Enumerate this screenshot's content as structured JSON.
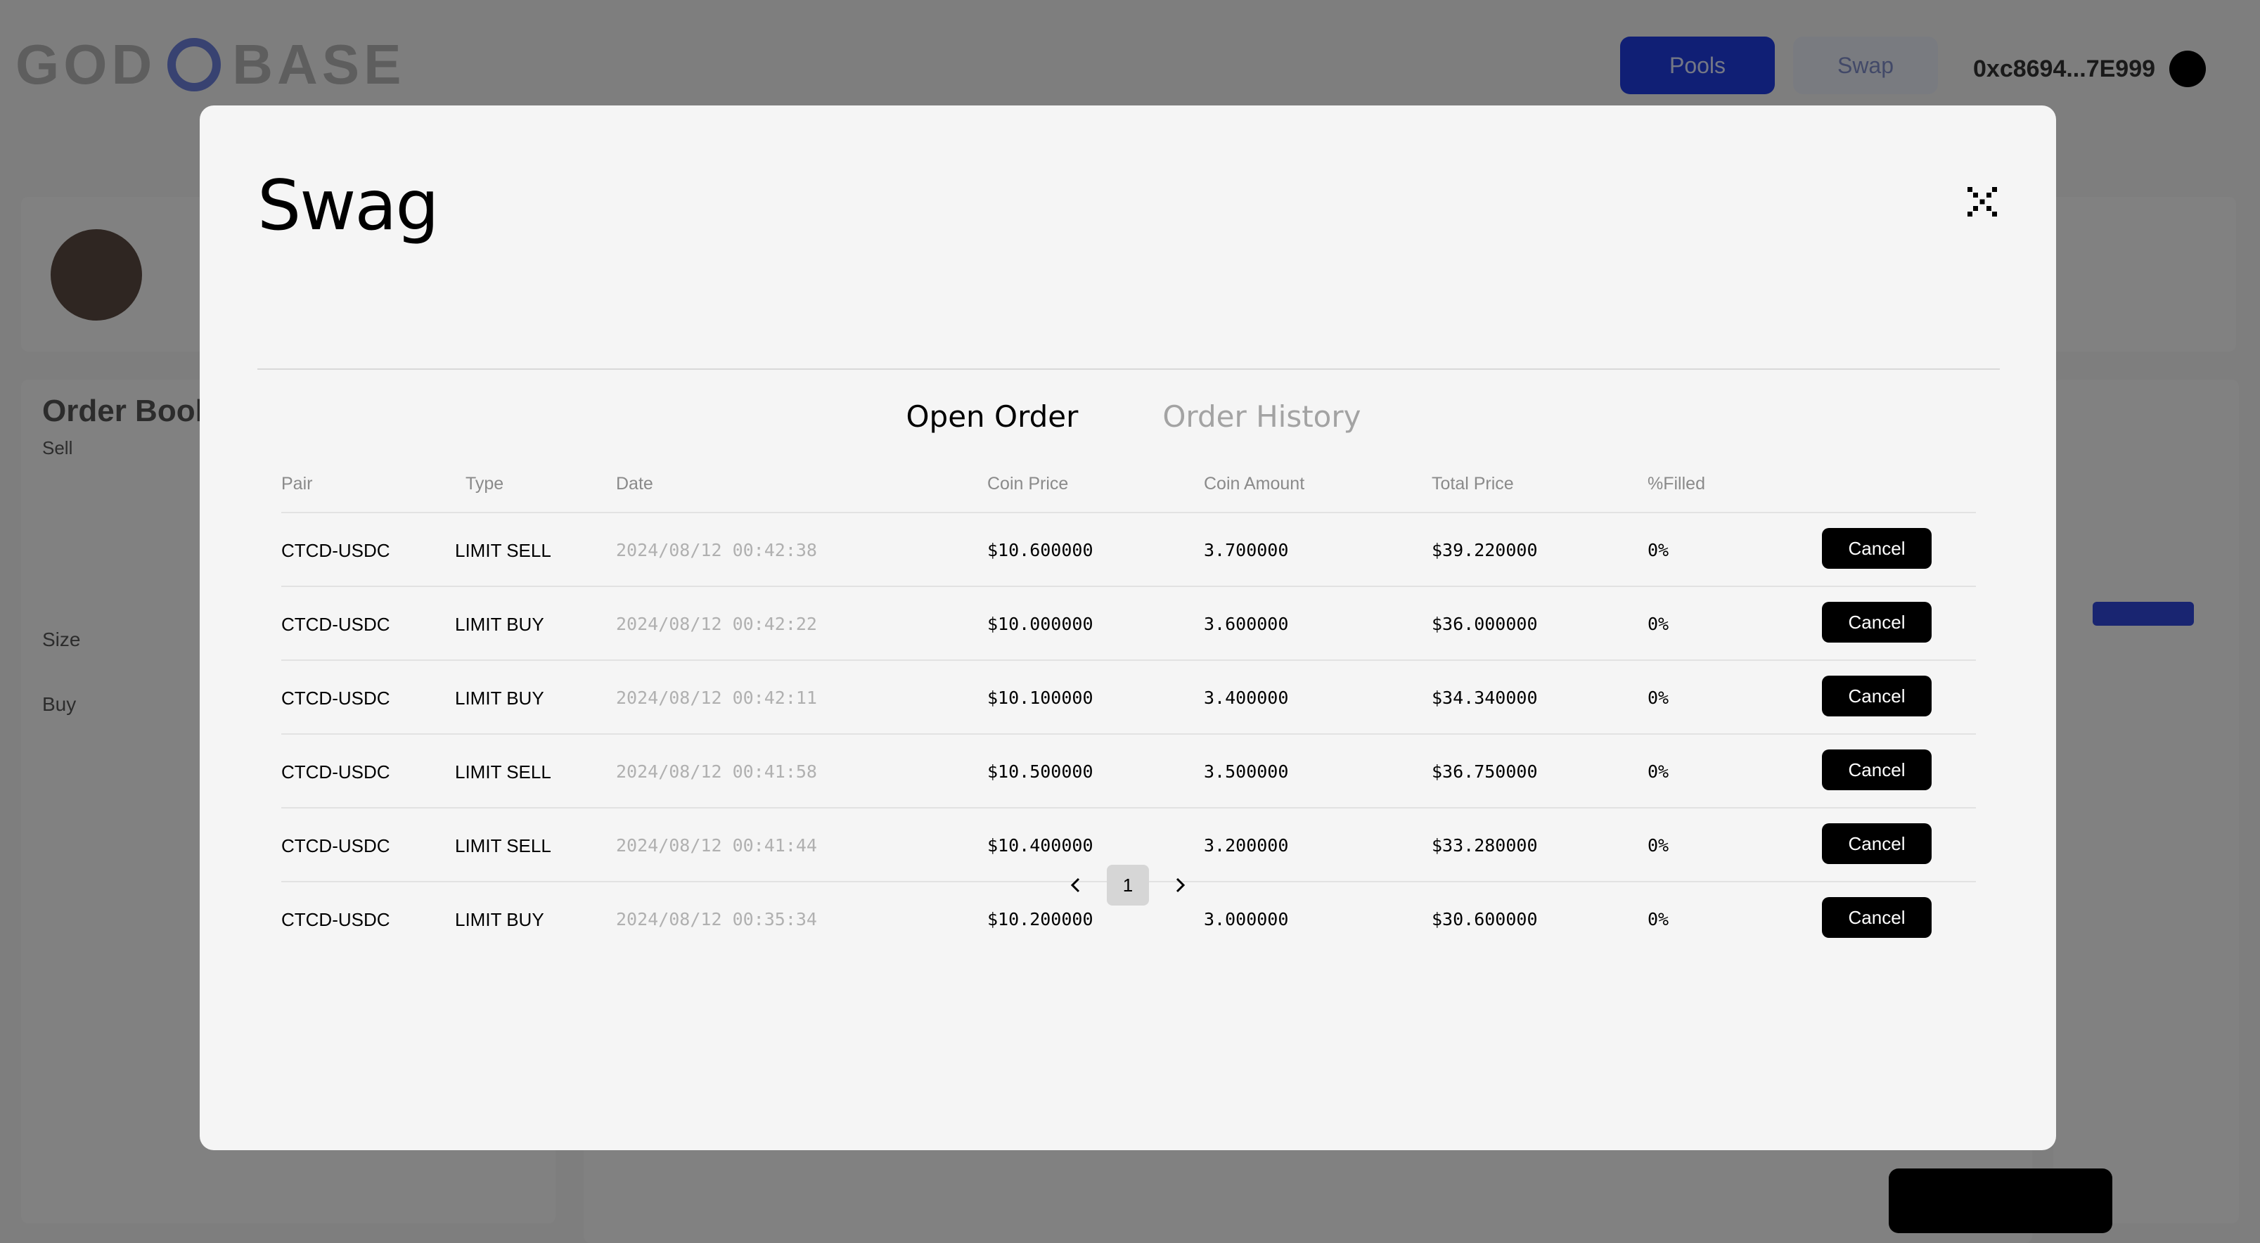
{
  "background": {
    "primary_button": "Pools",
    "secondary_button": "Swap",
    "wallet_address": "0xc8694...7E999",
    "side_labels": [
      "Order Book",
      "Sell",
      "Size",
      "Buy"
    ]
  },
  "modal": {
    "title": "Swag",
    "close_icon": "close-icon",
    "tabs": [
      {
        "label": "Open Order",
        "active": true
      },
      {
        "label": "Order History",
        "active": false
      }
    ],
    "columns": [
      "Pair",
      "Type",
      "Date",
      "Coin Price",
      "Coin Amount",
      "Total Price",
      "%Filled"
    ],
    "rows": [
      {
        "pair": "CTCD-USDC",
        "type": "LIMIT SELL",
        "date": "2024/08/12 00:42:38",
        "coin_price": "$10.600000",
        "coin_amount": "3.700000",
        "total_price": "$39.220000",
        "filled": "0%",
        "action": "Cancel"
      },
      {
        "pair": "CTCD-USDC",
        "type": "LIMIT BUY",
        "date": "2024/08/12 00:42:22",
        "coin_price": "$10.000000",
        "coin_amount": "3.600000",
        "total_price": "$36.000000",
        "filled": "0%",
        "action": "Cancel"
      },
      {
        "pair": "CTCD-USDC",
        "type": "LIMIT BUY",
        "date": "2024/08/12 00:42:11",
        "coin_price": "$10.100000",
        "coin_amount": "3.400000",
        "total_price": "$34.340000",
        "filled": "0%",
        "action": "Cancel"
      },
      {
        "pair": "CTCD-USDC",
        "type": "LIMIT SELL",
        "date": "2024/08/12 00:41:58",
        "coin_price": "$10.500000",
        "coin_amount": "3.500000",
        "total_price": "$36.750000",
        "filled": "0%",
        "action": "Cancel"
      },
      {
        "pair": "CTCD-USDC",
        "type": "LIMIT SELL",
        "date": "2024/08/12 00:41:44",
        "coin_price": "$10.400000",
        "coin_amount": "3.200000",
        "total_price": "$33.280000",
        "filled": "0%",
        "action": "Cancel"
      },
      {
        "pair": "CTCD-USDC",
        "type": "LIMIT BUY",
        "date": "2024/08/12 00:35:34",
        "coin_price": "$10.200000",
        "coin_amount": "3.000000",
        "total_price": "$30.600000",
        "filled": "0%",
        "action": "Cancel"
      }
    ],
    "pagination": {
      "current_page": "1",
      "prev_icon": "chevron-left-icon",
      "next_icon": "chevron-right-icon"
    }
  },
  "colors": {
    "primary_blue": "#1f3de0",
    "button_black": "#000000",
    "modal_bg": "#f5f5f5"
  }
}
